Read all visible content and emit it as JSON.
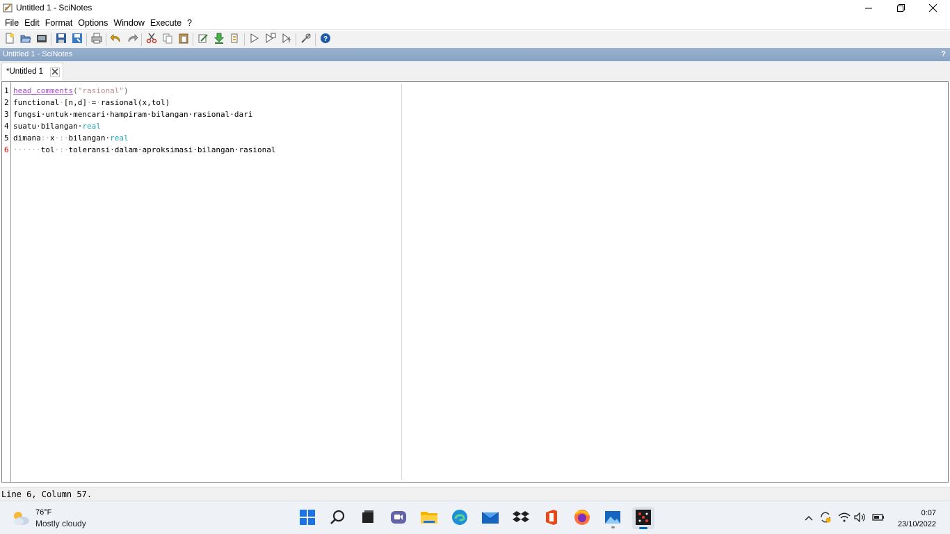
{
  "window": {
    "title": "Untitled 1 - SciNotes",
    "app_icon": "scinotes-icon",
    "controls": [
      "minimize-icon",
      "restore-icon",
      "close-icon"
    ]
  },
  "menu": {
    "items": [
      "File",
      "Edit",
      "Format",
      "Options",
      "Window",
      "Execute",
      "?"
    ]
  },
  "toolbar": {
    "groups": [
      [
        "new-file-icon",
        "open-file-icon",
        "open-recent-icon"
      ],
      [
        "save-icon",
        "save-as-icon"
      ],
      [
        "print-icon"
      ],
      [
        "undo-icon",
        "redo-icon"
      ],
      [
        "cut-icon",
        "copy-icon",
        "paste-icon"
      ],
      [
        "comment-icon",
        "load-into-scilab-icon",
        "evaluate-selection-icon"
      ],
      [
        "execute-icon",
        "execute-echo-icon",
        "execute-until-icon"
      ],
      [
        "tools-icon"
      ],
      [
        "help-icon"
      ]
    ]
  },
  "dock": {
    "title": "Untitled 1 - SciNotes",
    "help": "?"
  },
  "tab": {
    "label": "*Untitled 1"
  },
  "editor": {
    "current_line": 6,
    "lines": [
      {
        "n": "1",
        "tokens": [
          {
            "t": "head_comments",
            "c": "fn"
          },
          {
            "t": "(",
            "c": "op"
          },
          {
            "t": "\"rasional\"",
            "c": "str"
          },
          {
            "t": ")",
            "c": "op"
          }
        ]
      },
      {
        "n": "2",
        "tokens": [
          {
            "t": "functional",
            "c": ""
          },
          {
            "t": "·",
            "c": "dim"
          },
          {
            "t": "[n,d]",
            "c": ""
          },
          {
            "t": "·",
            "c": "dim"
          },
          {
            "t": "=",
            "c": ""
          },
          {
            "t": "·",
            "c": "dim"
          },
          {
            "t": "rasional(x,tol)",
            "c": ""
          }
        ]
      },
      {
        "n": "3",
        "tokens": [
          {
            "t": "fungsi·untuk·mencari·hampiram·bilangan·rasional·dari",
            "c": ""
          }
        ]
      },
      {
        "n": "4",
        "tokens": [
          {
            "t": "suatu·bilangan·",
            "c": ""
          },
          {
            "t": "real",
            "c": "kw"
          }
        ]
      },
      {
        "n": "5",
        "tokens": [
          {
            "t": "dimana",
            "c": ""
          },
          {
            "t": ":·",
            "c": "dim"
          },
          {
            "t": "x",
            "c": ""
          },
          {
            "t": "·:·",
            "c": "dim"
          },
          {
            "t": "bilangan·",
            "c": ""
          },
          {
            "t": "real",
            "c": "kw"
          }
        ]
      },
      {
        "n": "6",
        "tokens": [
          {
            "t": "······",
            "c": "dim"
          },
          {
            "t": "tol",
            "c": ""
          },
          {
            "t": "·:·",
            "c": "dim"
          },
          {
            "t": "toleransi·dalam·aproksimasi·bilangan·rasional",
            "c": ""
          }
        ]
      }
    ]
  },
  "status": {
    "text": "Line 6, Column 57."
  },
  "taskbar": {
    "weather": {
      "temp": "76°F",
      "desc": "Mostly cloudy",
      "icon": "partly-cloudy-icon"
    },
    "apps": [
      "start-icon",
      "search-icon",
      "task-view-icon",
      "chat-icon",
      "file-explorer-icon",
      "edge-icon",
      "mail-icon",
      "dropbox-icon",
      "office-icon",
      "firefox-icon",
      "photos-icon",
      "scilab-icon"
    ],
    "tray": [
      "chevron-up-icon",
      "sync-icon",
      "wifi-icon",
      "volume-icon",
      "battery-icon"
    ],
    "clock": {
      "time": "0:07",
      "date": "23/10/2022"
    }
  }
}
